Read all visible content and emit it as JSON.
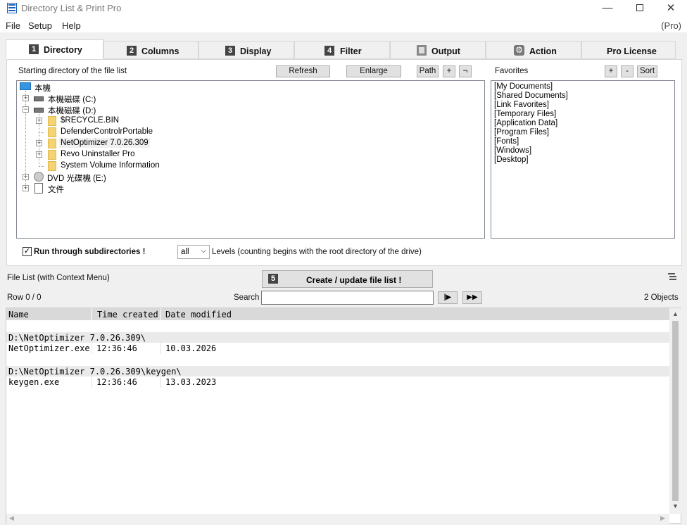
{
  "window": {
    "title": "Directory List & Print Pro",
    "minimize": "—",
    "close": "✕"
  },
  "menu": {
    "file": "File",
    "setup": "Setup",
    "help": "Help",
    "edition": "(Pro)"
  },
  "tabs": [
    {
      "num": "1",
      "label": "Directory"
    },
    {
      "num": "2",
      "label": "Columns"
    },
    {
      "num": "3",
      "label": "Display"
    },
    {
      "num": "4",
      "label": "Filter"
    },
    {
      "label": "Output",
      "icon": "output-icon"
    },
    {
      "label": "Action",
      "icon": "gear-icon"
    },
    {
      "label": "Pro License"
    }
  ],
  "directory": {
    "start_label": "Starting directory of the file list",
    "refresh": "Refresh",
    "enlarge": "Enlarge",
    "path": "Path",
    "plus": "+",
    "neg": "¬",
    "tree": {
      "root": "本機",
      "drive_c": "本機磁碟 (C:)",
      "drive_d": "本機磁碟 (D:)",
      "folders": [
        "$RECYCLE.BIN",
        "DefenderControlrPortable",
        "NetOptimizer 7.0.26.309",
        "Revo Uninstaller Pro",
        "System Volume Information"
      ],
      "dvd": "DVD 光碟機 (E:)",
      "docs": "文件"
    },
    "favorites_label": "Favorites",
    "fav_plus": "+",
    "fav_minus": "-",
    "fav_sort": "Sort",
    "favorites": [
      "[My Documents]",
      "[Shared Documents]",
      "[Link Favorites]",
      "[Temporary Files]",
      "[Application Data]",
      "[Program Files]",
      "[Fonts]",
      "[Windows]",
      "[Desktop]"
    ],
    "subdirs_label": "Run through subdirectories !",
    "subdirs_checked": "✓",
    "levels_value": "all",
    "levels_text": "Levels  (counting begins with the root directory of the drive)"
  },
  "filelist": {
    "label": "File List (with Context Menu)",
    "create_num": "5",
    "create_label": "Create / update file list !",
    "row_info": "Row 0 / 0",
    "search_label": "Search",
    "search_value": "",
    "nav_next": "|▶",
    "nav_last": "▶▶",
    "objects": "2 Objects",
    "columns": [
      "Name",
      "Time created",
      "Date modified"
    ],
    "groups": [
      {
        "path": "D:\\NetOptimizer 7.0.26.309\\",
        "name": "NetOptimizer.exe",
        "time": "12:36:46",
        "date": "10.03.2026"
      },
      {
        "path": "D:\\NetOptimizer 7.0.26.309\\keygen\\",
        "name": "keygen.exe",
        "time": "12:36:46",
        "date": "13.03.2023"
      }
    ]
  }
}
